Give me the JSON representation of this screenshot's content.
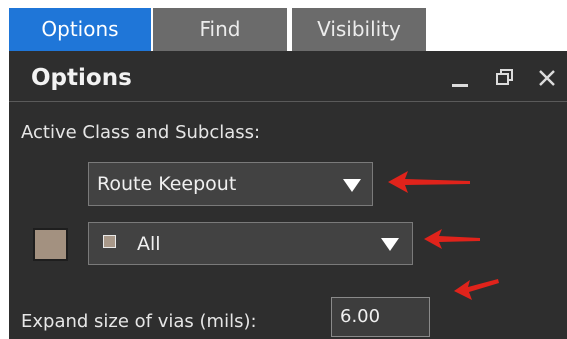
{
  "tabs": [
    {
      "label": "Options",
      "active": true
    },
    {
      "label": "Find",
      "active": false
    },
    {
      "label": "Visibility",
      "active": false
    }
  ],
  "panel": {
    "title": "Options",
    "minimize_icon": "minimize-icon",
    "restore_icon": "restore-icon",
    "close_icon": "close-icon"
  },
  "active_class": {
    "label": "Active Class and Subclass:",
    "class_value": "Route Keepout",
    "subclass_value": "All",
    "subclass_color": "#a39180"
  },
  "vias": {
    "label": "Expand size of vias (mils):",
    "value": "6.00"
  },
  "colors": {
    "accent_tab": "#1f76d8",
    "panel_bg": "#2e2e2e",
    "annotation_arrow": "#e0231b"
  }
}
